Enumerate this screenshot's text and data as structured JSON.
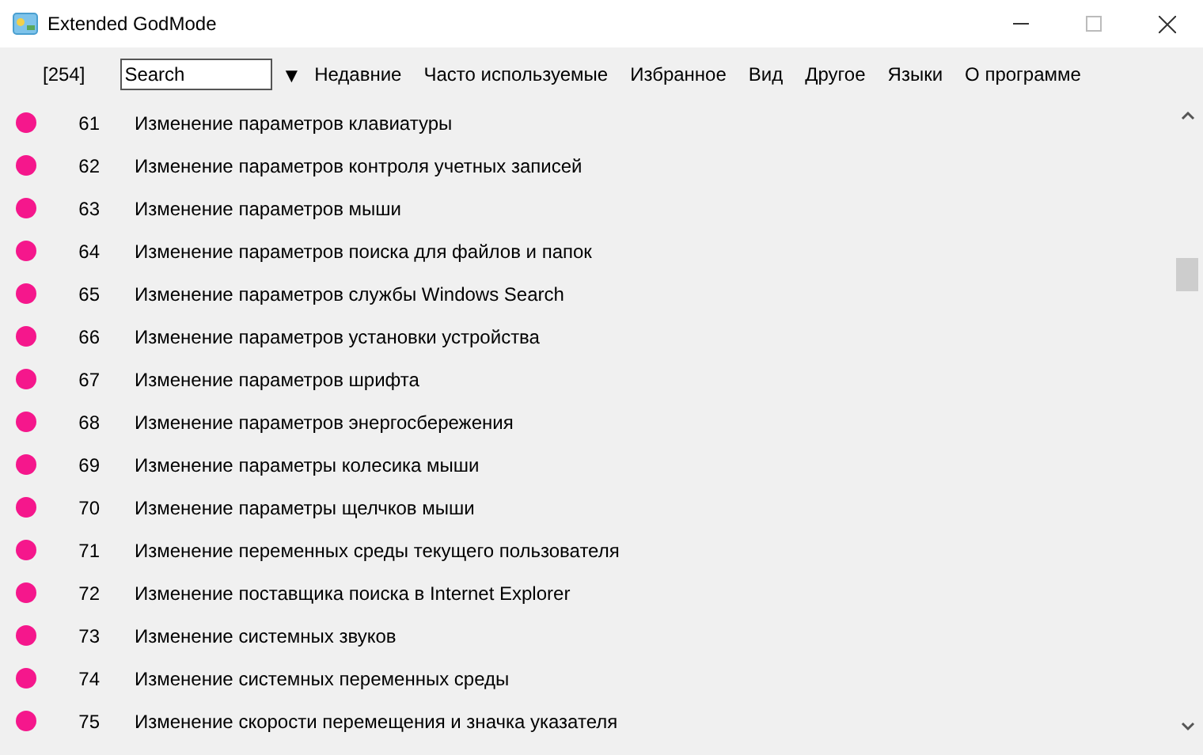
{
  "window": {
    "title": "Extended GodMode"
  },
  "toolbar": {
    "count": "[254]",
    "search": {
      "value": "Search"
    },
    "dropdown": "▼",
    "menu": [
      "Недавние",
      "Часто используемые",
      "Избранное",
      "Вид",
      "Другое",
      "Языки",
      "О программе"
    ]
  },
  "items": [
    {
      "number": "61",
      "label": "Изменение параметров клавиатуры"
    },
    {
      "number": "62",
      "label": "Изменение параметров контроля учетных записей"
    },
    {
      "number": "63",
      "label": "Изменение параметров мыши"
    },
    {
      "number": "64",
      "label": "Изменение параметров поиска для файлов и папок"
    },
    {
      "number": "65",
      "label": "Изменение параметров службы Windows Search"
    },
    {
      "number": "66",
      "label": "Изменение параметров установки устройства"
    },
    {
      "number": "67",
      "label": "Изменение параметров шрифта"
    },
    {
      "number": "68",
      "label": "Изменение параметров энергосбережения"
    },
    {
      "number": "69",
      "label": "Изменение параметры колесика мыши"
    },
    {
      "number": "70",
      "label": "Изменение параметры щелчков мыши"
    },
    {
      "number": "71",
      "label": "Изменение переменных среды текущего пользователя"
    },
    {
      "number": "72",
      "label": "Изменение поставщика поиска в Internet Explorer"
    },
    {
      "number": "73",
      "label": "Изменение системных звуков"
    },
    {
      "number": "74",
      "label": "Изменение системных переменных среды"
    },
    {
      "number": "75",
      "label": "Изменение скорости перемещения и значка указателя"
    }
  ]
}
